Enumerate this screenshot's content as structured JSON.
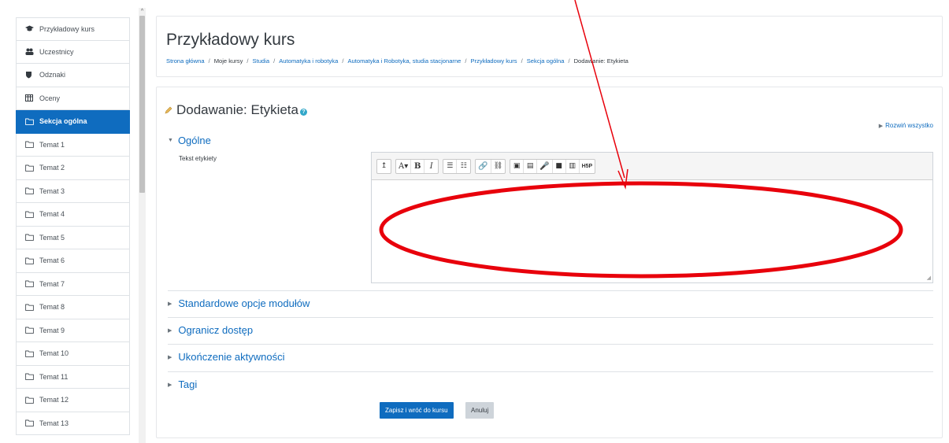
{
  "sidebar": {
    "items": [
      {
        "label": "Przykładowy kurs",
        "icon": "graduation-cap-icon"
      },
      {
        "label": "Uczestnicy",
        "icon": "users-icon"
      },
      {
        "label": "Odznaki",
        "icon": "shield-icon"
      },
      {
        "label": "Oceny",
        "icon": "table-icon"
      },
      {
        "label": "Sekcja ogólna",
        "icon": "folder-icon",
        "active": true
      },
      {
        "label": "Temat 1",
        "icon": "folder-icon"
      },
      {
        "label": "Temat 2",
        "icon": "folder-icon"
      },
      {
        "label": "Temat 3",
        "icon": "folder-icon"
      },
      {
        "label": "Temat 4",
        "icon": "folder-icon"
      },
      {
        "label": "Temat 5",
        "icon": "folder-icon"
      },
      {
        "label": "Temat 6",
        "icon": "folder-icon"
      },
      {
        "label": "Temat 7",
        "icon": "folder-icon"
      },
      {
        "label": "Temat 8",
        "icon": "folder-icon"
      },
      {
        "label": "Temat 9",
        "icon": "folder-icon"
      },
      {
        "label": "Temat 10",
        "icon": "folder-icon"
      },
      {
        "label": "Temat 11",
        "icon": "folder-icon"
      },
      {
        "label": "Temat 12",
        "icon": "folder-icon"
      },
      {
        "label": "Temat 13",
        "icon": "folder-icon"
      }
    ]
  },
  "header": {
    "title": "Przykładowy kurs",
    "breadcrumb": [
      {
        "label": "Strona główna",
        "link": true
      },
      {
        "label": "Moje kursy",
        "link": false
      },
      {
        "label": "Studia",
        "link": true
      },
      {
        "label": "Automatyka i robotyka",
        "link": true
      },
      {
        "label": "Automatyka i Robotyka, studia stacjonarne",
        "link": true
      },
      {
        "label": "Przykładowy kurs",
        "link": true
      },
      {
        "label": "Sekcja ogólna",
        "link": true
      },
      {
        "label": "Dodawanie: Etykieta",
        "link": false
      }
    ]
  },
  "form": {
    "title": "Dodawanie: Etykieta",
    "help_glyph": "?",
    "expand_all": "Rozwiń wszystko",
    "section_general": "Ogólne",
    "field_label": "Tekst etykiety",
    "editor_value": "",
    "toolbar": [
      [
        "↥"
      ],
      [
        "A▾",
        "B",
        "I"
      ],
      [
        "☰",
        "☷"
      ],
      [
        "🔗",
        "⛓"
      ],
      [
        "▣",
        "▤",
        "🎤",
        "■",
        "▥",
        "H5P"
      ]
    ],
    "sections": [
      "Standardowe opcje modułów",
      "Ogranicz dostęp",
      "Ukończenie aktywności",
      "Tagi"
    ],
    "save_label": "Zapisz i wróć do kursu",
    "cancel_label": "Anuluj"
  },
  "colors": {
    "accent": "#0f6cbf",
    "annotation": "#e8000b"
  }
}
